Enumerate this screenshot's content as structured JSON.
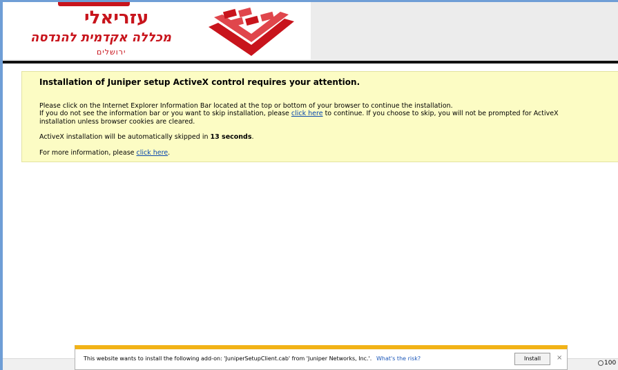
{
  "header": {
    "logo_name": "עזריאלי",
    "logo_sub": "מכללה אקדמית להנדסה",
    "logo_city": "ירושלים",
    "brand_color": "#c8141c"
  },
  "notice": {
    "title": "Installation of Juniper setup ActiveX control requires your attention.",
    "line1": "Please click on the Internet Explorer Information Bar located at the top or bottom of your browser to continue the installation.",
    "line2_pre": "If you do not see the information bar or you want to skip installation, please ",
    "line2_link": "click here",
    "line2_post": " to continue. If you choose to skip, you will not be prompted for ActiveX",
    "line3": "installation unless browser cookies are cleared.",
    "countdown_pre": "ActiveX installation will be automatically skipped in ",
    "countdown_value": "13 seconds",
    "countdown_post": ".",
    "more_pre": "For more information, please ",
    "more_link": "click here",
    "more_post": ".",
    "background_color": "#fcfcc4"
  },
  "infobar": {
    "message": "This website wants to install the following add-on: 'JuniperSetupClient.cab' from 'Juniper Networks, Inc.'.",
    "risk_link": "What's the risk?",
    "install_label": "Install",
    "close_glyph": "×",
    "accent_color": "#f2b317"
  },
  "statusbar": {
    "zoom": "100"
  }
}
